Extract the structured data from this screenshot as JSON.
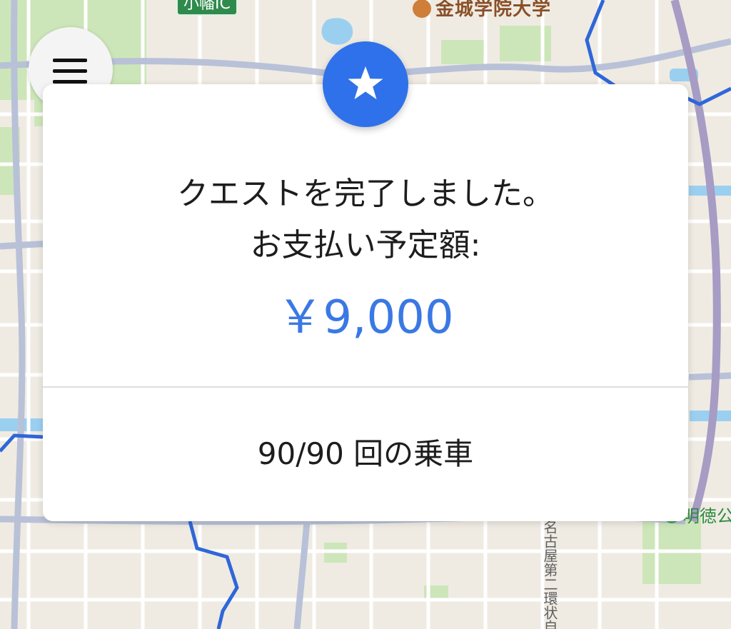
{
  "menu": {
    "icon": "hamburger-menu-icon"
  },
  "map": {
    "labels": {
      "university": "金城学院大学",
      "interchange": "小幡IC",
      "park": "明徳公",
      "road": "名古屋第二環状自"
    },
    "icons": {
      "university": "school-icon",
      "park": "park-icon"
    }
  },
  "quest_card": {
    "badge_icon": "star-icon",
    "title_line_1": "クエストを完了しました。",
    "title_line_2": "お支払い予定額:",
    "amount": "￥9,000",
    "rides": "90/90 回の乗車"
  },
  "colors": {
    "accent": "#2f71ea",
    "amount_text": "#3a78e4",
    "route": "#2f67d8",
    "map_background": "#efebe3",
    "road": "#b8c1d7",
    "park": "#cde6b9",
    "water": "#9bcff0"
  }
}
